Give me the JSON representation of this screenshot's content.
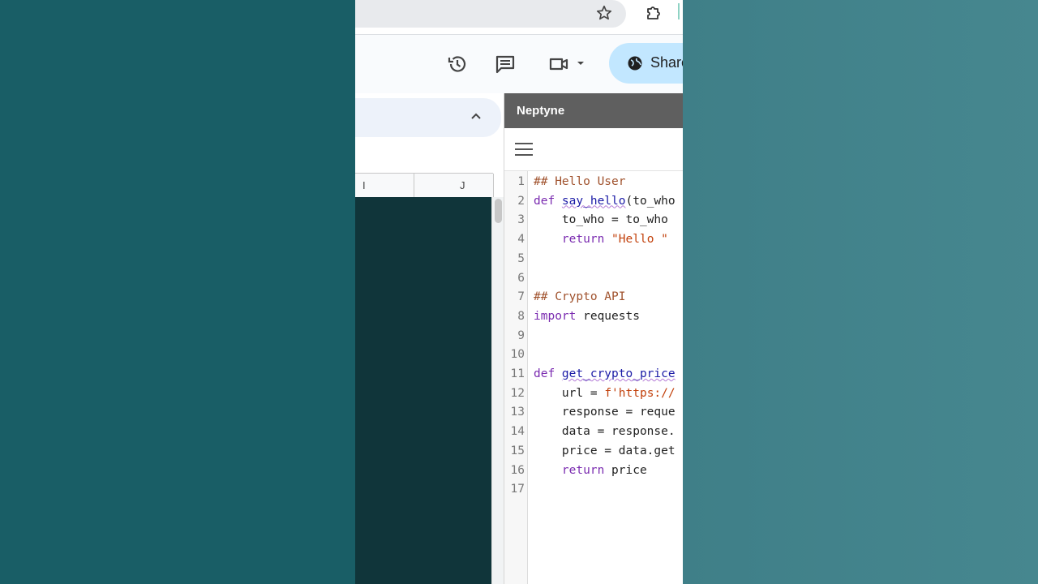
{
  "sheet": {
    "columns": [
      "I",
      "J"
    ]
  },
  "toolbar": {
    "share_label": "Share",
    "icons": [
      "history-icon",
      "comment-icon",
      "meet-icon",
      "chevron-down-icon",
      "globe-icon"
    ]
  },
  "panel": {
    "title": "Neptyne",
    "lines": [
      {
        "n": "1",
        "parts": [
          {
            "t": "## Hello User",
            "c": "cm"
          }
        ]
      },
      {
        "n": "2",
        "parts": [
          {
            "t": "def ",
            "c": "kw"
          },
          {
            "t": "say_hello",
            "c": "fn"
          },
          {
            "t": "(to_who",
            "c": ""
          }
        ]
      },
      {
        "n": "3",
        "parts": [
          {
            "t": "    to_who = to_who",
            "c": ""
          }
        ]
      },
      {
        "n": "4",
        "parts": [
          {
            "t": "    ",
            "c": ""
          },
          {
            "t": "return",
            "c": "kw"
          },
          {
            "t": " ",
            "c": ""
          },
          {
            "t": "\"Hello \"",
            "c": "st"
          }
        ]
      },
      {
        "n": "5",
        "parts": []
      },
      {
        "n": "6",
        "parts": []
      },
      {
        "n": "7",
        "parts": [
          {
            "t": "## Crypto API",
            "c": "cm"
          }
        ]
      },
      {
        "n": "8",
        "parts": [
          {
            "t": "import",
            "c": "kw"
          },
          {
            "t": " requests",
            "c": ""
          }
        ]
      },
      {
        "n": "9",
        "parts": []
      },
      {
        "n": "10",
        "parts": []
      },
      {
        "n": "11",
        "parts": [
          {
            "t": "def ",
            "c": "kw"
          },
          {
            "t": "get_crypto_price",
            "c": "fn"
          }
        ]
      },
      {
        "n": "12",
        "parts": [
          {
            "t": "    url = ",
            "c": ""
          },
          {
            "t": "f'https://",
            "c": "st"
          }
        ]
      },
      {
        "n": "13",
        "parts": [
          {
            "t": "    response = reque",
            "c": ""
          }
        ]
      },
      {
        "n": "14",
        "parts": [
          {
            "t": "    data = response.",
            "c": ""
          }
        ]
      },
      {
        "n": "15",
        "parts": [
          {
            "t": "    price = data.get",
            "c": ""
          }
        ]
      },
      {
        "n": "16",
        "parts": [
          {
            "t": "    ",
            "c": ""
          },
          {
            "t": "return",
            "c": "kw"
          },
          {
            "t": " price",
            "c": ""
          }
        ]
      },
      {
        "n": "17",
        "parts": []
      }
    ]
  },
  "colors": {
    "share_bg": "#c2e7ff",
    "panel_header": "#5f5f5f",
    "keyword": "#7a2bb0",
    "comment": "#a0522d",
    "string": "#c2410c",
    "function": "#1a1aa6"
  }
}
